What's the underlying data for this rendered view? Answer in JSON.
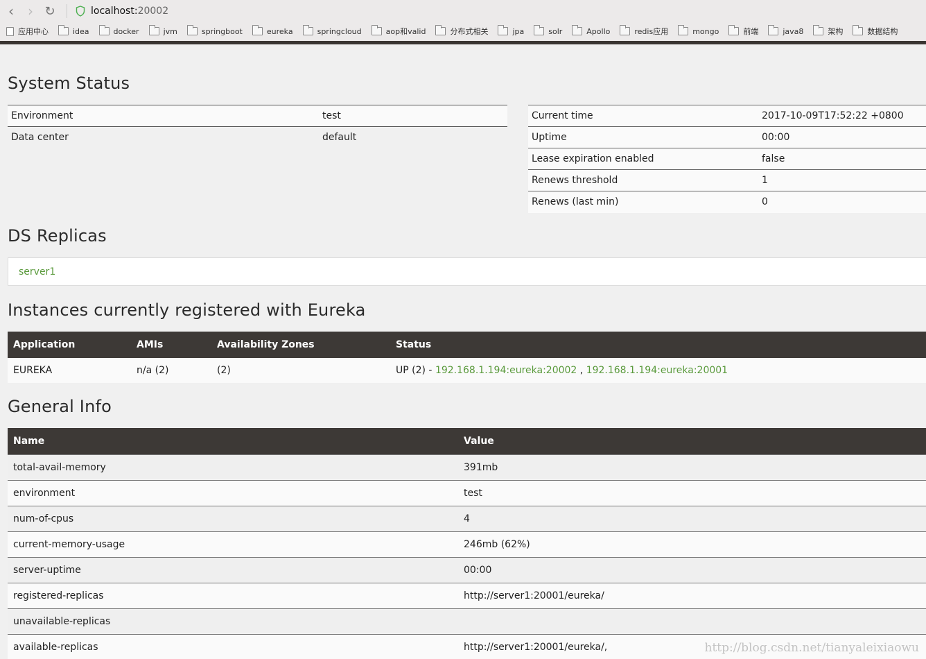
{
  "browser": {
    "url_host": "localhost:",
    "url_port": "20002",
    "bookmarks": [
      "应用中心",
      "idea",
      "docker",
      "jvm",
      "springboot",
      "eureka",
      "springcloud",
      "aop和valid",
      "分布式相关",
      "jpa",
      "solr",
      "Apollo",
      "redis应用",
      "mongo",
      "前端",
      "java8",
      "架构",
      "数据结构"
    ]
  },
  "system_status": {
    "title": "System Status",
    "left": [
      {
        "k": "Environment",
        "v": "test"
      },
      {
        "k": "Data center",
        "v": "default"
      }
    ],
    "right": [
      {
        "k": "Current time",
        "v": "2017-10-09T17:52:22 +0800"
      },
      {
        "k": "Uptime",
        "v": "00:00"
      },
      {
        "k": "Lease expiration enabled",
        "v": "false"
      },
      {
        "k": "Renews threshold",
        "v": "1"
      },
      {
        "k": "Renews (last min)",
        "v": "0"
      }
    ]
  },
  "ds_replicas": {
    "title": "DS Replicas",
    "items": [
      "server1"
    ]
  },
  "instances": {
    "title": "Instances currently registered with Eureka",
    "headers": [
      "Application",
      "AMIs",
      "Availability Zones",
      "Status"
    ],
    "rows": [
      {
        "application": "EUREKA",
        "amis": "n/a (2)",
        "zones": "(2)",
        "status_prefix": "UP (2) - ",
        "links": [
          "192.168.1.194:eureka:20002",
          "192.168.1.194:eureka:20001"
        ],
        "link_sep": " , "
      }
    ]
  },
  "general_info": {
    "title": "General Info",
    "headers": [
      "Name",
      "Value"
    ],
    "rows": [
      {
        "n": "total-avail-memory",
        "v": "391mb"
      },
      {
        "n": "environment",
        "v": "test"
      },
      {
        "n": "num-of-cpus",
        "v": "4"
      },
      {
        "n": "current-memory-usage",
        "v": "246mb (62%)"
      },
      {
        "n": "server-uptime",
        "v": "00:00"
      },
      {
        "n": "registered-replicas",
        "v": "http://server1:20001/eureka/"
      },
      {
        "n": "unavailable-replicas",
        "v": ""
      },
      {
        "n": "available-replicas",
        "v": "http://server1:20001/eureka/,"
      }
    ]
  },
  "watermark": "http://blog.csdn.net/tianyaleixiaowu"
}
